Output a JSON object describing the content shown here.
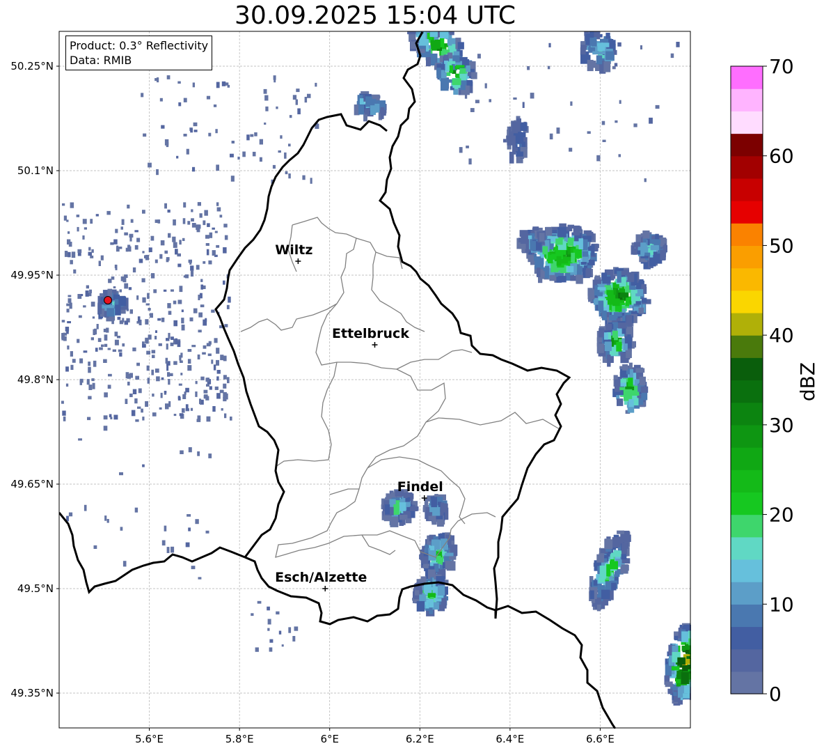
{
  "title": "30.09.2025 15:04 UTC",
  "info": {
    "product": "Product: 0.3° Reflectivity",
    "data": "Data: RMIB"
  },
  "map": {
    "lon_range": [
      5.4,
      6.8
    ],
    "lat_range": [
      49.3,
      50.3
    ],
    "grid": true,
    "lat_ticks": [
      {
        "value": 50.25,
        "label": "50.25°N"
      },
      {
        "value": 50.1,
        "label": "50.1°N"
      },
      {
        "value": 49.95,
        "label": "49.95°N"
      },
      {
        "value": 49.8,
        "label": "49.8°N"
      },
      {
        "value": 49.65,
        "label": "49.65°N"
      },
      {
        "value": 49.5,
        "label": "49.5°N"
      },
      {
        "value": 49.35,
        "label": "49.35°N"
      }
    ],
    "lon_ticks": [
      {
        "value": 5.6,
        "label": "5.6°E"
      },
      {
        "value": 5.8,
        "label": "5.8°E"
      },
      {
        "value": 6.0,
        "label": "6°E"
      },
      {
        "value": 6.2,
        "label": "6.2°E"
      },
      {
        "value": 6.4,
        "label": "6.4°E"
      },
      {
        "value": 6.6,
        "label": "6.6°E"
      }
    ],
    "cities": [
      {
        "name": "Wiltz",
        "lon": 5.93,
        "lat": 49.97
      },
      {
        "name": "Ettelbruck",
        "lon": 6.1,
        "lat": 49.85
      },
      {
        "name": "Findel",
        "lon": 6.21,
        "lat": 49.63
      },
      {
        "name": "Esch/Alzette",
        "lon": 5.99,
        "lat": 49.5
      }
    ],
    "radar_site": {
      "lon": 5.505,
      "lat": 49.915,
      "color": "#e8141e"
    }
  },
  "colorbar": {
    "label": "dBZ",
    "ticks": [
      0,
      10,
      20,
      30,
      40,
      50,
      60,
      70
    ],
    "vmin": 0,
    "vmax": 70,
    "step": 2.5,
    "colors": [
      "#6474a4",
      "#5466a0",
      "#425ea2",
      "#4a78b0",
      "#5c9ec8",
      "#66c0dc",
      "#60d8c4",
      "#3ed66c",
      "#16c820",
      "#14ba18",
      "#10a814",
      "#0e9612",
      "#0c8410",
      "#0a700e",
      "#0a5e0c",
      "#4a7a0c",
      "#b0b008",
      "#fad600",
      "#fab800",
      "#fa9e00",
      "#fa8200",
      "#e60000",
      "#c80000",
      "#a20000",
      "#7c0000",
      "#ffdcff",
      "#ffb4ff",
      "#ff6eff",
      "#e83ae8"
    ]
  }
}
